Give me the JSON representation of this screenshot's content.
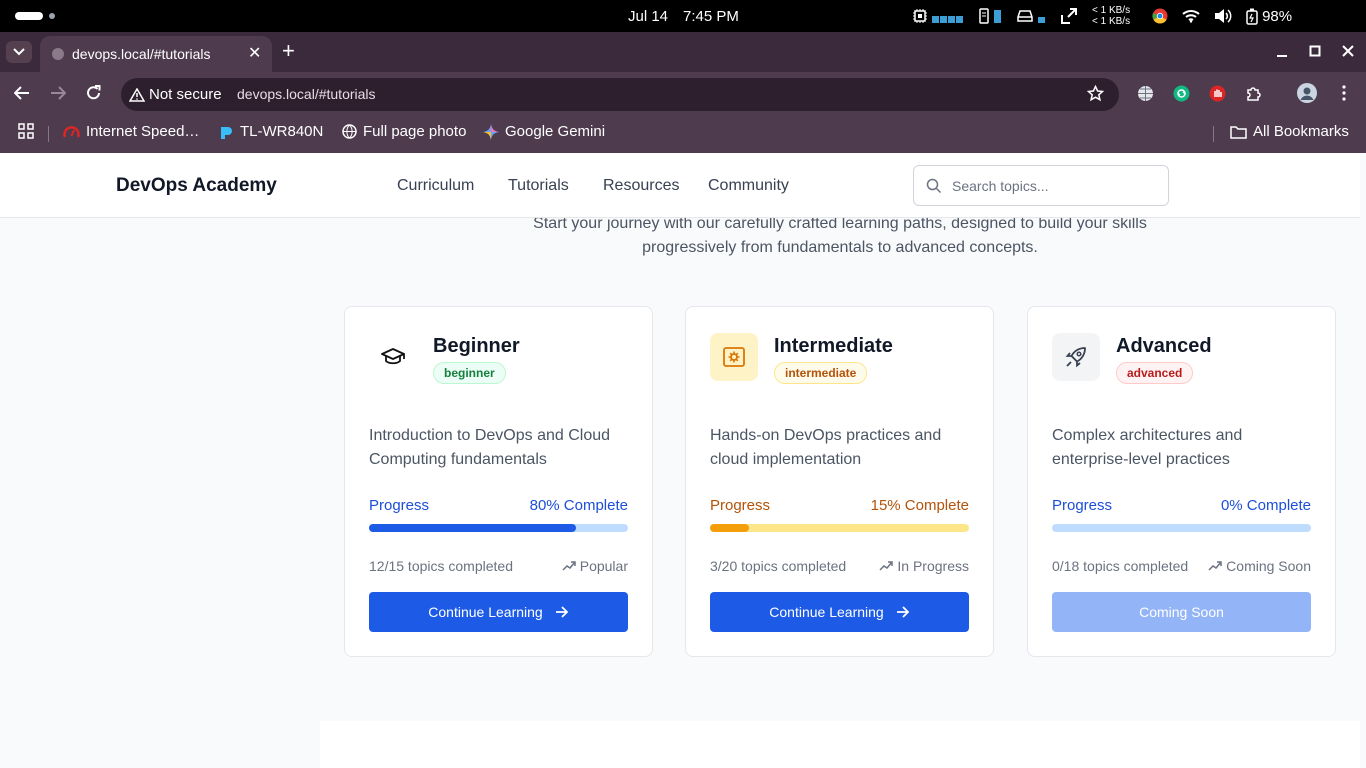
{
  "os": {
    "date": "Jul 14",
    "time": "7:45 PM",
    "net_up": "< 1 KB/s",
    "net_down": "< 1 KB/s",
    "battery": "98%"
  },
  "browser": {
    "tab_title": "devops.local/#tutorials",
    "security_label": "Not secure",
    "url": "devops.local/#tutorials",
    "bookmarks": [
      "Internet Speed…",
      "TL-WR840N",
      "Full page photo",
      "Google Gemini"
    ],
    "all_bookmarks": "All Bookmarks"
  },
  "site": {
    "brand": "DevOps Academy",
    "nav": [
      "Curriculum",
      "Tutorials",
      "Resources",
      "Community"
    ],
    "search_placeholder": "Search topics...",
    "intro_line1": "Start your journey with our carefully crafted learning paths, designed to build your skills",
    "intro_line2": "progressively from fundamentals to advanced concepts."
  },
  "cards": [
    {
      "title": "Beginner",
      "badge": "beginner",
      "icon": "graduation-cap-icon",
      "description": "Introduction to DevOps and Cloud Computing fundamentals",
      "progress_label": "Progress",
      "progress_text": "80% Complete",
      "progress": 0.8,
      "topics": "12/15 topics completed",
      "tag": "Popular",
      "button": "Continue Learning",
      "accent": "#1d5be6"
    },
    {
      "title": "Intermediate",
      "badge": "intermediate",
      "icon": "cog-box-icon",
      "description": "Hands-on DevOps practices and cloud implementation",
      "progress_label": "Progress",
      "progress_text": "15% Complete",
      "progress": 0.15,
      "topics": "3/20 topics completed",
      "tag": "In Progress",
      "button": "Continue Learning",
      "accent": "#d97706"
    },
    {
      "title": "Advanced",
      "badge": "advanced",
      "icon": "rocket-icon",
      "description": "Complex architectures and enterprise-level practices",
      "progress_label": "Progress",
      "progress_text": "0% Complete",
      "progress": 0,
      "topics": "0/18 topics completed",
      "tag": "Coming Soon",
      "button": "Coming Soon",
      "accent": "#1d5be6"
    }
  ]
}
